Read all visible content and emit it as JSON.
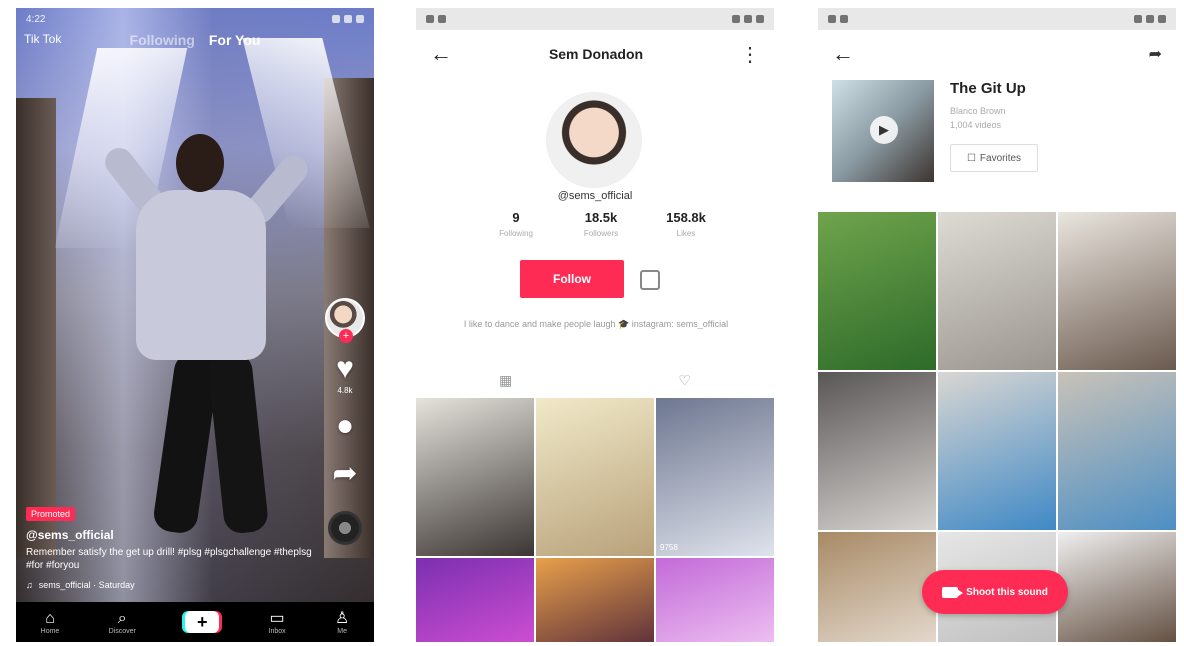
{
  "feed": {
    "status_time": "4:22",
    "live_label": "Tik Tok",
    "tabs": {
      "following": "Following",
      "for_you": "For You"
    },
    "promoted_badge": "Promoted",
    "username": "@sems_official",
    "caption": "Remember satisfy the get up drill! #plsg #plsgchallenge #theplsg #for #foryou",
    "sound": "sems_official · Saturday",
    "side": {
      "like_count": "4.8k",
      "comment_count": "",
      "share_label": ""
    },
    "nav": [
      {
        "glyph": "⌂",
        "label": "Home"
      },
      {
        "glyph": "⌕",
        "label": "Discover"
      },
      {
        "glyph": "+",
        "label": ""
      },
      {
        "glyph": "▭",
        "label": "Inbox"
      },
      {
        "glyph": "♙",
        "label": "Me"
      }
    ]
  },
  "profile": {
    "title": "Sem Donadon",
    "handle": "@sems_official",
    "stats": [
      {
        "value": "9",
        "label": "Following"
      },
      {
        "value": "18.5k",
        "label": "Followers"
      },
      {
        "value": "158.8k",
        "label": "Likes"
      }
    ],
    "follow_label": "Follow",
    "bio": "I like to dance and make people laugh 🎓 instagram: sems_official",
    "tile_views": [
      "",
      "",
      "9758"
    ],
    "tile_colors": [
      [
        "#e6e2dc",
        "#3b3633"
      ],
      [
        "#f1e9c9",
        "#b8a27a"
      ],
      [
        "#6e7791",
        "#dfe3ec"
      ],
      [
        "#7b2fb0",
        "#d04fd3"
      ],
      [
        "#e8a04b",
        "#5a2e3a"
      ],
      [
        "#c26ad8",
        "#efc2f2"
      ]
    ]
  },
  "sound_page": {
    "title": "The Git Up",
    "subtitle1": "Blanco Brown",
    "subtitle2": "1,004 videos",
    "favorites_label": "Favorites",
    "shoot_label": "Shoot this sound",
    "tile_colors": [
      [
        "#6fa44c",
        "#2e6b2a"
      ],
      [
        "#dedad4",
        "#9a958f"
      ],
      [
        "#e9e5df",
        "#6b5a4e"
      ],
      [
        "#595656",
        "#d8d4d1"
      ],
      [
        "#d9d6d2",
        "#3f89c6"
      ],
      [
        "#c9c2b8",
        "#4d8fc4"
      ],
      [
        "#a88a66",
        "#e7ddd2"
      ],
      [
        "#e6e6e6",
        "#bdbdbd"
      ],
      [
        "#efefef",
        "#5b4637"
      ]
    ]
  },
  "colors": {
    "accent": "#fe2c55",
    "cyan": "#25f4ee"
  }
}
